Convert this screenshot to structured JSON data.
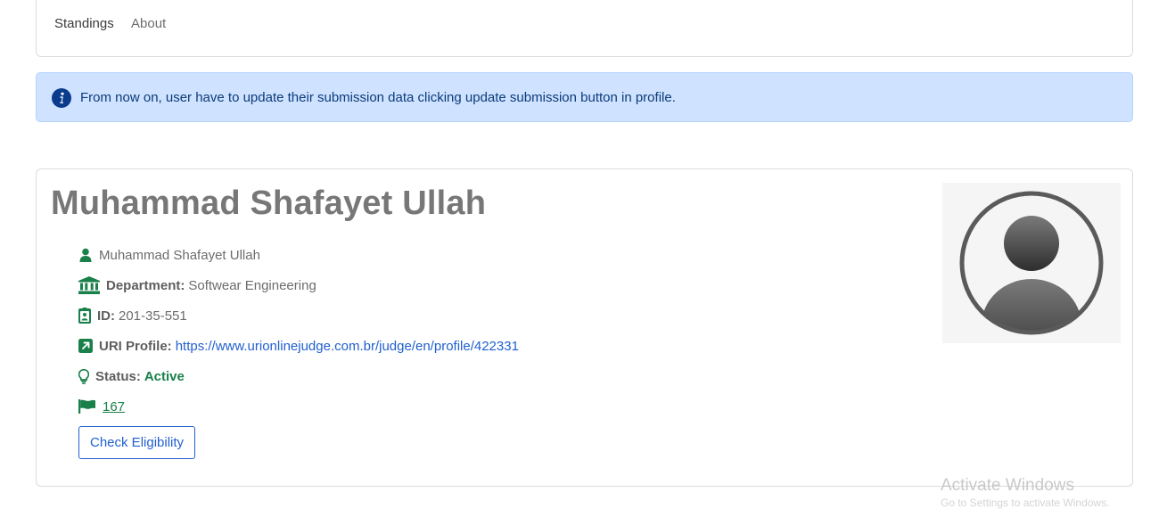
{
  "nav": {
    "items": [
      {
        "label": "Standings"
      },
      {
        "label": "About"
      }
    ]
  },
  "alert": {
    "icon": "info-icon",
    "text": "From now on, user have to update their submission data clicking update submission button in profile."
  },
  "profile": {
    "title": "Muhammad Shafayet Ullah",
    "name": "Muhammad Shafayet Ullah",
    "department_label": "Department:",
    "department": "Softwear Engineering",
    "id_label": "ID:",
    "id": "201-35-551",
    "uri_label": "URI Profile:",
    "uri_url": "https://www.urionlinejudge.com.br/judge/en/profile/422331",
    "status_label": "Status:",
    "status": "Active",
    "solved_count": "167",
    "check_button": "Check Eligibility",
    "avatar_icon": "user-avatar-icon"
  },
  "watermark": {
    "title": "Activate Windows",
    "subtitle": "Go to Settings to activate Windows."
  },
  "colors": {
    "accent_green": "#19804a",
    "link_blue": "#2160d0",
    "alert_bg": "#cfe2ff",
    "alert_icon": "#0a3b8c"
  }
}
